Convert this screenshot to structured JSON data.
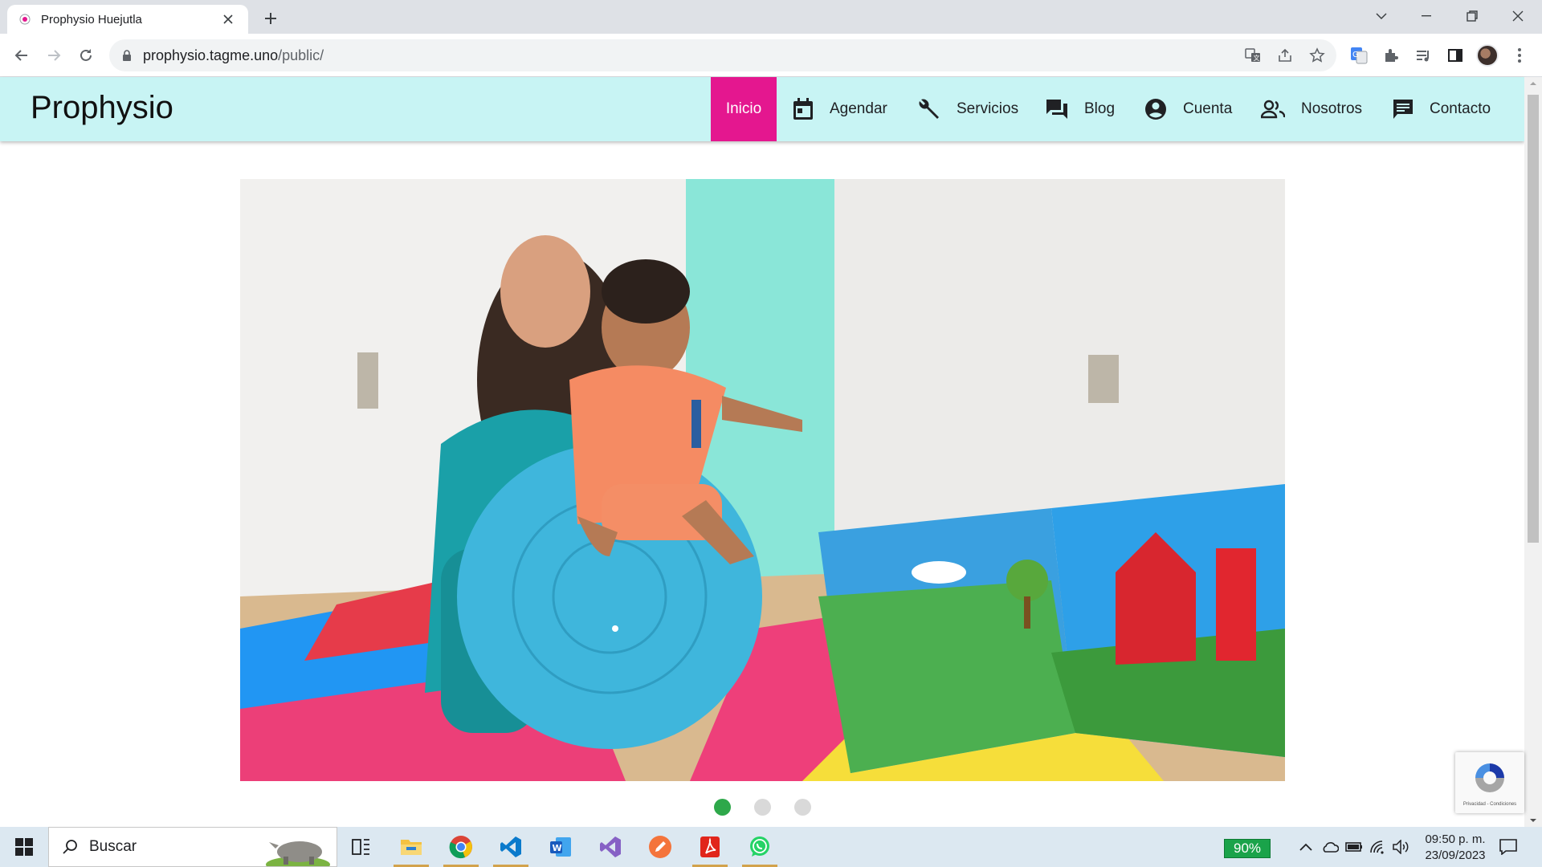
{
  "browser": {
    "tab_title": "Prophysio Huejutla",
    "url_host": "prophysio.tagme.uno",
    "url_path": "/public/"
  },
  "site": {
    "brand": "Prophysio",
    "nav": {
      "inicio": "Inicio",
      "agendar": "Agendar",
      "servicios": "Servicios",
      "blog": "Blog",
      "cuenta": "Cuenta",
      "nosotros": "Nosotros",
      "contacto": "Contacto"
    },
    "accent_color": "#e4178f",
    "nav_background": "#c8f4f4",
    "carousel": {
      "slide_count": 3,
      "active_slide": 1,
      "active_dot_color": "#2ea84a",
      "inactive_dot_color": "#d9d9d9"
    },
    "recaptcha_text": "Privacidad - Condiciones"
  },
  "taskbar": {
    "search_placeholder": "Buscar",
    "battery": "90%",
    "time": "09:50 p. m.",
    "date": "23/09/2023"
  }
}
